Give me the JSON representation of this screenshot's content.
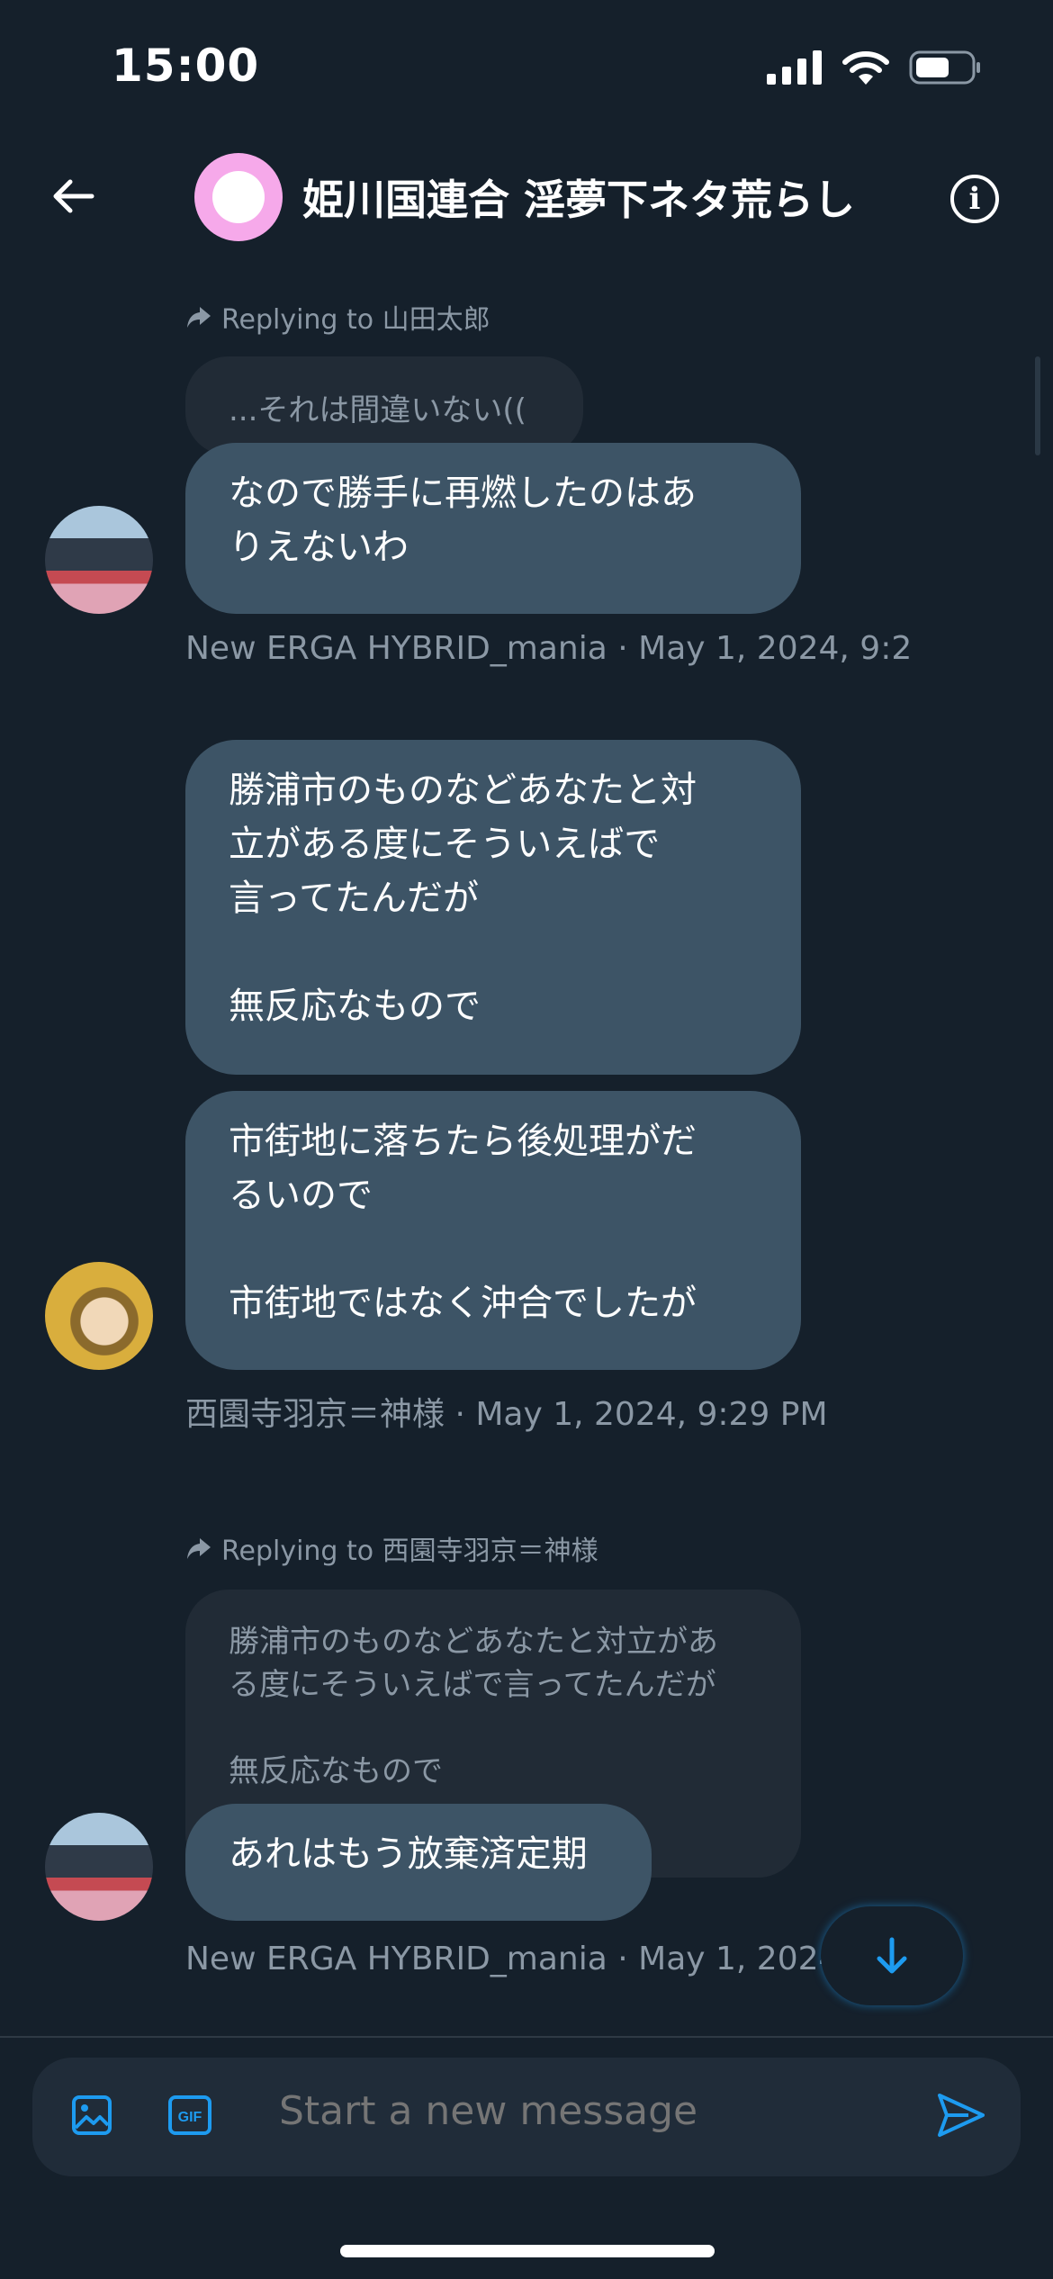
{
  "status": {
    "time": "15:00"
  },
  "header": {
    "title": "姫川国連合 淫夢下ネタ荒らし"
  },
  "messages": {
    "m1": {
      "reply_label": "Replying to 山田太郎",
      "quoted": "...それは間違いない((",
      "text": "なので勝手に再燃したのはあ\nりえないわ",
      "meta": "New ERGA HYBRID_mania · May 1, 2024, 9:2"
    },
    "m2": {
      "text": "勝浦市のものなどあなたと対\n立がある度にそういえばで\n言ってたんだが\n\n無反応なもので"
    },
    "m3": {
      "text": "市街地に落ちたら後処理がだ\nるいので\n\n市街地ではなく沖合でしたが",
      "meta": "西園寺羽京＝神様 · May 1, 2024, 9:29 PM"
    },
    "m4": {
      "reply_label": "Replying to 西園寺羽京＝神様",
      "quoted": "勝浦市のものなどあなたと対立があ\nる度にそういえばで言ってたんだが\n\n無反応なもので",
      "text": "あれはもう放棄済定期",
      "meta": "New ERGA HYBRID_mania · May 1, 2024,"
    }
  },
  "composer": {
    "placeholder": "Start a new message"
  },
  "colors": {
    "background": "#15202b",
    "bubble": "#3d5466",
    "accent": "#1d9bf0"
  },
  "icons": [
    "back-arrow-icon",
    "info-icon",
    "reply-arrow-icon",
    "image-icon",
    "gif-icon",
    "send-icon",
    "arrow-down-icon",
    "signal-icon",
    "wifi-icon",
    "battery-icon"
  ]
}
